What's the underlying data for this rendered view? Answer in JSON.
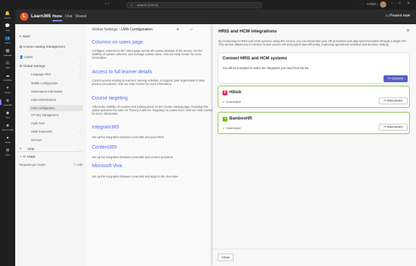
{
  "window": {
    "search_placeholder": "Search (Ctrl+E)",
    "org": "compo...",
    "minimize": "–",
    "maximize": "□",
    "close": "✕",
    "more": "···"
  },
  "rail": {
    "items": [
      {
        "label": "Activity",
        "icon": "bell-icon",
        "glyph": "🔔"
      },
      {
        "label": "Chat",
        "icon": "chat-icon",
        "glyph": "💬"
      },
      {
        "label": "Teams",
        "icon": "teams-icon",
        "glyph": "👥"
      },
      {
        "label": "Calendar",
        "icon": "calendar-icon",
        "glyph": "▦"
      },
      {
        "label": "Calls",
        "icon": "phone-icon",
        "glyph": "☏"
      },
      {
        "label": "OneDrive",
        "icon": "cloud-icon",
        "glyph": "☁"
      },
      {
        "label": "Copilot",
        "icon": "copilot-icon",
        "glyph": "✦"
      },
      {
        "label": "Learn365",
        "icon": "learn365-icon",
        "glyph": "◉"
      },
      {
        "label": "Viva",
        "icon": "viva-icon",
        "glyph": "◆"
      },
      {
        "label": "Perform 365",
        "icon": "perform-icon",
        "glyph": "◈"
      },
      {
        "label": "Assist",
        "icon": "assist-icon",
        "glyph": "●"
      },
      {
        "label": "Apps",
        "icon": "apps-icon",
        "glyph": "⊞"
      }
    ]
  },
  "app": {
    "logo_letter": "L",
    "title": "Learn365",
    "tabs": [
      "Home",
      "Chat",
      "Shared"
    ],
    "present_label": "Present now",
    "present_icon": "present-icon"
  },
  "sidebar": {
    "items": [
      {
        "label": "Back",
        "icon": "back-arrow-icon"
      },
      {
        "label": "Course catalog management",
        "icon": "catalog-icon"
      },
      {
        "label": "Users",
        "icon": "users-icon"
      },
      {
        "label": "Global Settings",
        "icon": "settings-icon"
      }
    ],
    "subitems": [
      "Language Files",
      "Mobile Configuration",
      "Subscription Information",
      "LMS Administrators",
      "LMS Configuration",
      "API key management",
      "Audit Trail",
      "Skills framework",
      "Surveys"
    ],
    "help": "Help",
    "ai_usage": "AI usage",
    "requests_label": "Requests per month",
    "requests_value": "1/30"
  },
  "main": {
    "breadcrumb_root": "Global Settings",
    "breadcrumb_sep": "›",
    "breadcrumb_current": "LMS Configuration",
    "sections": [
      {
        "title": "Columns on users page",
        "desc": "Configure columns on the Users page across all course catalogs of the tenant. Set the visibility of system columns, and manage custom ones. Visit our Help Center for more information."
      },
      {
        "title": "Access to full learner details",
        "desc": "Control access relating to learners' training activities, to support your organization's data privacy procedures. Visit our Help Center for more information."
      },
      {
        "title": "Course targeting",
        "desc": "Affects the visibility of courses and training plans on the course catalog page. Enabling this option activates the rules for 'Tommy Audience Targeting' at course level. Visit our Help Center for more information."
      },
      {
        "title": "Integrate365",
        "desc": "Set up the integration between Learn365 and your HRIS."
      },
      {
        "title": "Content365",
        "desc": "Set up the integration between Learn365 and content providers."
      },
      {
        "title": "Microsoft Viva",
        "desc": "Set up the integration between Learn365 and apps in the Viva suite."
      }
    ]
  },
  "panel": {
    "title": "HRIS and HCM integrations",
    "close": "✕",
    "description": "By connecting to HRIS and HCM systems using this service, you can streamline your HR processes and data synchronization through a single API. This service allows you to connect to and access HR and payroll data efficiently, improving operational workflow and decision making.",
    "connect_card": {
      "title": "Connect HRIS and HCM systems",
      "desc": "You will be prompted to select the integration you need from the list.",
      "button": "Connect"
    },
    "providers": [
      {
        "name": "Hibob",
        "logo_letter": "b",
        "logo_color": "#e0245e",
        "status": "Connected",
        "button": "Disconnect"
      },
      {
        "name": "BambooHR",
        "logo_letter": "~",
        "logo_color": "#73c41d",
        "status": "Connected",
        "button": "Disconnect"
      }
    ],
    "footer_close": "Close"
  },
  "colors": {
    "accent": "#5b5fc7",
    "link": "#4f6bed",
    "connected": "#13a10e",
    "card_border_connected": "#92c353",
    "logo": "#e8562a"
  }
}
